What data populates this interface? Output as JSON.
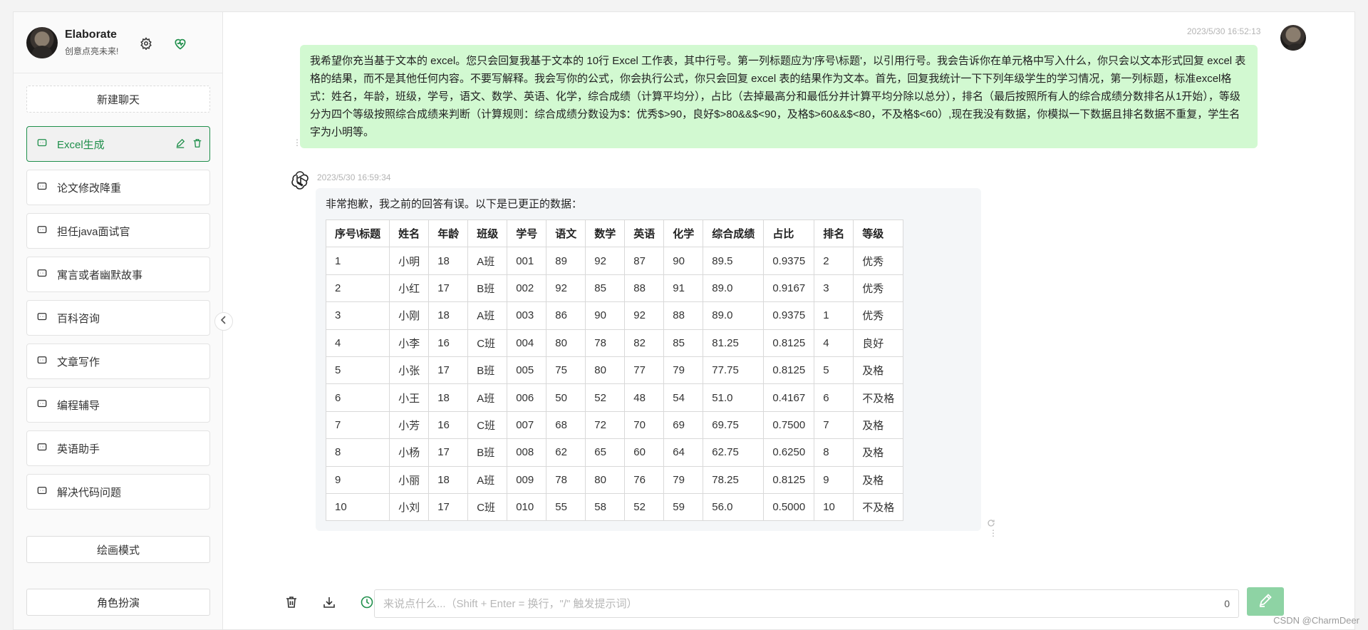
{
  "user": {
    "name": "Elaborate",
    "subtitle": "创意点亮未来!"
  },
  "sidebar": {
    "new_chat_label": "新建聊天",
    "items": [
      {
        "label": "Excel生成",
        "active": true
      },
      {
        "label": "论文修改降重"
      },
      {
        "label": "担任java面试官"
      },
      {
        "label": "寓言或者幽默故事"
      },
      {
        "label": "百科咨询"
      },
      {
        "label": "文章写作"
      },
      {
        "label": "编程辅导"
      },
      {
        "label": "英语助手"
      },
      {
        "label": "解决代码问题"
      }
    ],
    "draw_mode_label": "绘画模式",
    "role_play_label": "角色扮演"
  },
  "conversation": {
    "user_message": {
      "timestamp": "2023/5/30 16:52:13",
      "text": "我希望你充当基于文本的 excel。您只会回复我基于文本的 10行 Excel 工作表，其中行号。第一列标题应为'序号\\标题'，以引用行号。我会告诉你在单元格中写入什么，你只会以文本形式回复 excel 表格的结果，而不是其他任何内容。不要写解释。我会写你的公式，你会执行公式，你只会回复 excel 表的结果作为文本。首先，回复我统计一下下列年级学生的学习情况，第一列标题，标准excel格式：姓名，年龄，班级，学号，语文、数学、英语、化学，综合成绩（计算平均分），占比（去掉最高分和最低分并计算平均分除以总分），排名（最后按照所有人的综合成绩分数排名从1开始），等级分为四个等级按照综合成绩来判断（计算规则：综合成绩分数设为$：优秀$>90，良好$>80&&$<90，及格$>60&&$<80，不及格$<60）,现在我没有数据，你模拟一下数据且排名数据不重复，学生名字为小明等。"
    },
    "bot_message": {
      "timestamp": "2023/5/30 16:59:34",
      "intro": "非常抱歉，我之前的回答有误。以下是已更正的数据：",
      "table": {
        "headers": [
          "序号\\标题",
          "姓名",
          "年龄",
          "班级",
          "学号",
          "语文",
          "数学",
          "英语",
          "化学",
          "综合成绩",
          "占比",
          "排名",
          "等级"
        ],
        "rows": [
          [
            "1",
            "小明",
            "18",
            "A班",
            "001",
            "89",
            "92",
            "87",
            "90",
            "89.5",
            "0.9375",
            "2",
            "优秀"
          ],
          [
            "2",
            "小红",
            "17",
            "B班",
            "002",
            "92",
            "85",
            "88",
            "91",
            "89.0",
            "0.9167",
            "3",
            "优秀"
          ],
          [
            "3",
            "小刚",
            "18",
            "A班",
            "003",
            "86",
            "90",
            "92",
            "88",
            "89.0",
            "0.9375",
            "1",
            "优秀"
          ],
          [
            "4",
            "小李",
            "16",
            "C班",
            "004",
            "80",
            "78",
            "82",
            "85",
            "81.25",
            "0.8125",
            "4",
            "良好"
          ],
          [
            "5",
            "小张",
            "17",
            "B班",
            "005",
            "75",
            "80",
            "77",
            "79",
            "77.75",
            "0.8125",
            "5",
            "及格"
          ],
          [
            "6",
            "小王",
            "18",
            "A班",
            "006",
            "50",
            "52",
            "48",
            "54",
            "51.0",
            "0.4167",
            "6",
            "不及格"
          ],
          [
            "7",
            "小芳",
            "16",
            "C班",
            "007",
            "68",
            "72",
            "70",
            "69",
            "69.75",
            "0.7500",
            "7",
            "及格"
          ],
          [
            "8",
            "小杨",
            "17",
            "B班",
            "008",
            "62",
            "65",
            "60",
            "64",
            "62.75",
            "0.6250",
            "8",
            "及格"
          ],
          [
            "9",
            "小丽",
            "18",
            "A班",
            "009",
            "78",
            "80",
            "76",
            "79",
            "78.25",
            "0.8125",
            "9",
            "及格"
          ],
          [
            "10",
            "小刘",
            "17",
            "C班",
            "010",
            "55",
            "58",
            "52",
            "59",
            "56.0",
            "0.5000",
            "10",
            "不及格"
          ]
        ]
      }
    }
  },
  "input": {
    "value": "",
    "placeholder": "来说点什么...（Shift + Enter = 换行，\"/\" 触发提示词）",
    "char_count": "0"
  },
  "watermark": "CSDN @CharmDeer",
  "colors": {
    "accent": "#1f8f4b",
    "user_bubble": "#d2f9d1",
    "send_button": "#8ed3a4"
  }
}
